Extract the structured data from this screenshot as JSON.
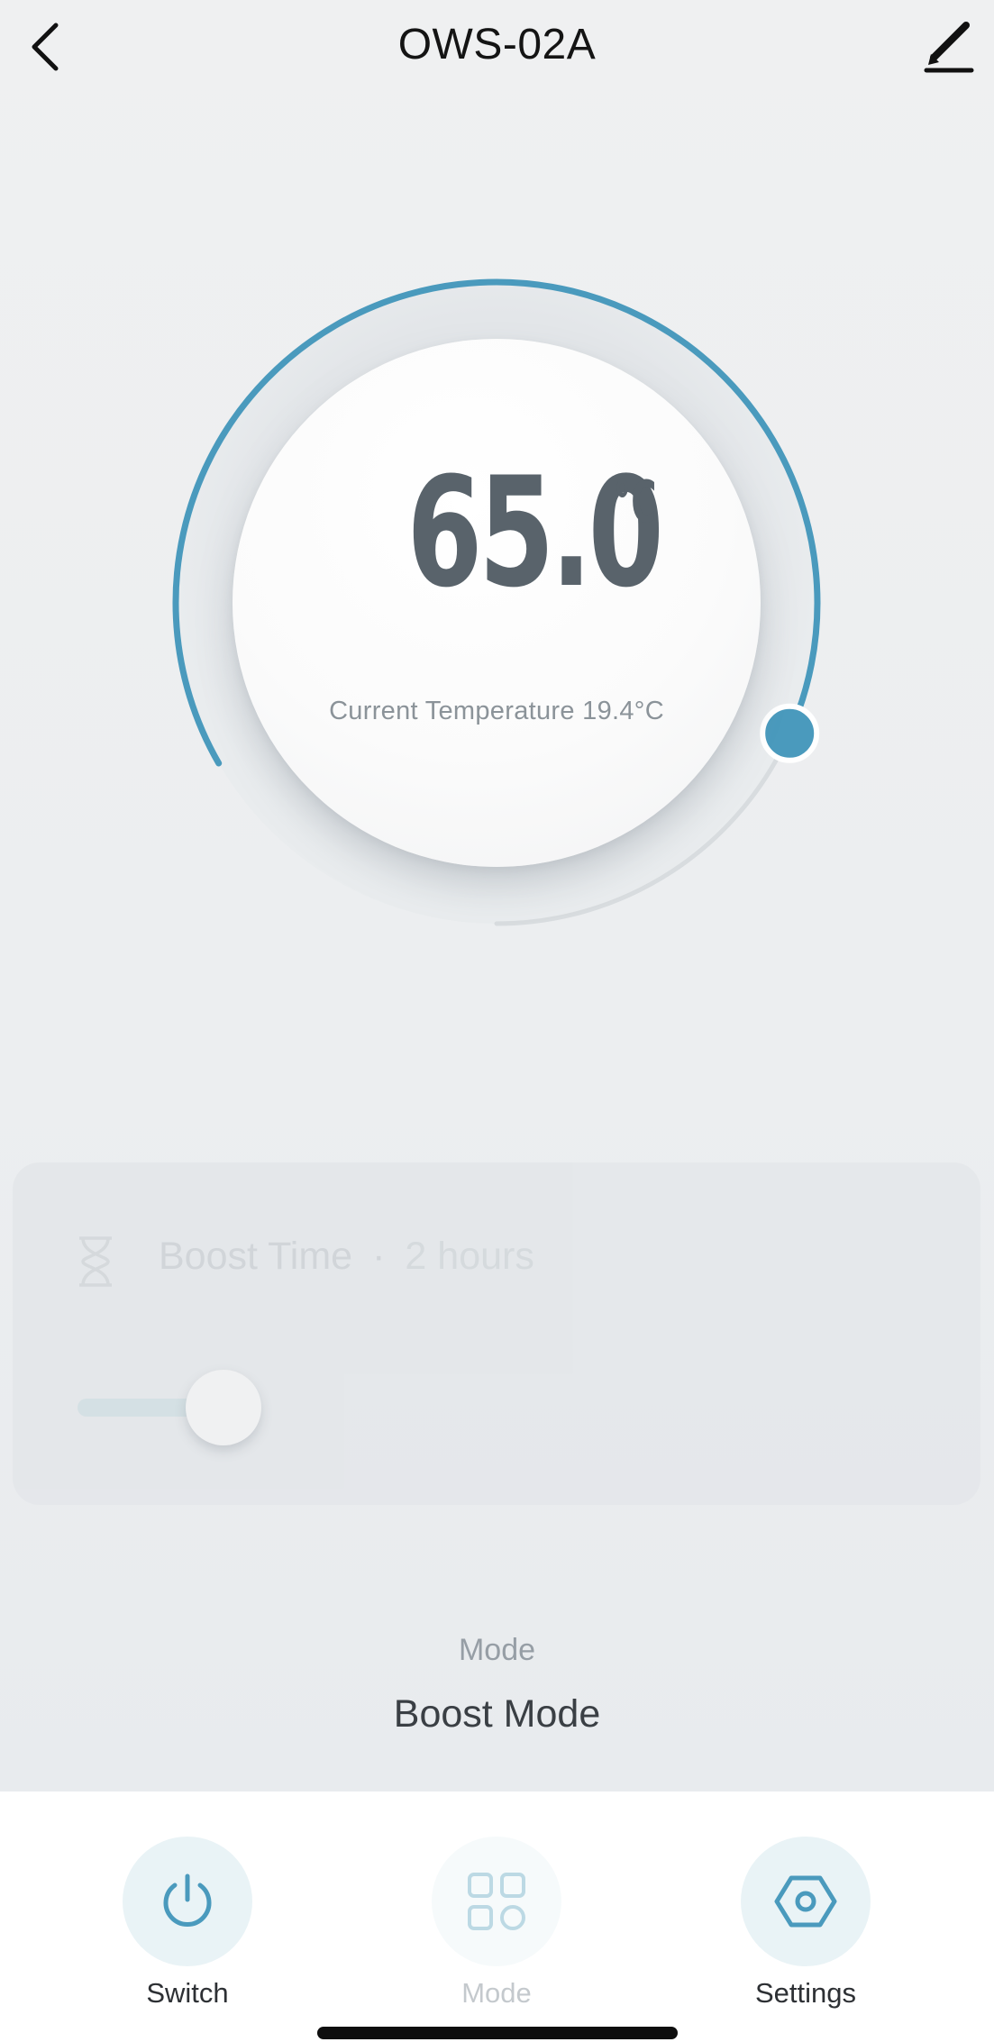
{
  "header": {
    "title": "OWS-02A",
    "back_icon": "chevron-left-icon",
    "edit_icon": "pencil-icon"
  },
  "thermostat": {
    "set_temperature": "65.0",
    "unit": "°C",
    "current_temperature_label": "Current Temperature 19.4°C",
    "dial_fraction": 0.78,
    "accent_color": "#4a9abd"
  },
  "boost": {
    "label": "Boost Time",
    "separator": "·",
    "value": "2 hours",
    "slider_fraction": 0.12,
    "icon": "hourglass-icon"
  },
  "mode": {
    "caption": "Mode",
    "value": "Boost Mode"
  },
  "tabs": [
    {
      "label": "Switch",
      "icon": "power-icon"
    },
    {
      "label": "Mode",
      "icon": "grid-icon"
    },
    {
      "label": "Settings",
      "icon": "hexagon-gear-icon"
    }
  ]
}
